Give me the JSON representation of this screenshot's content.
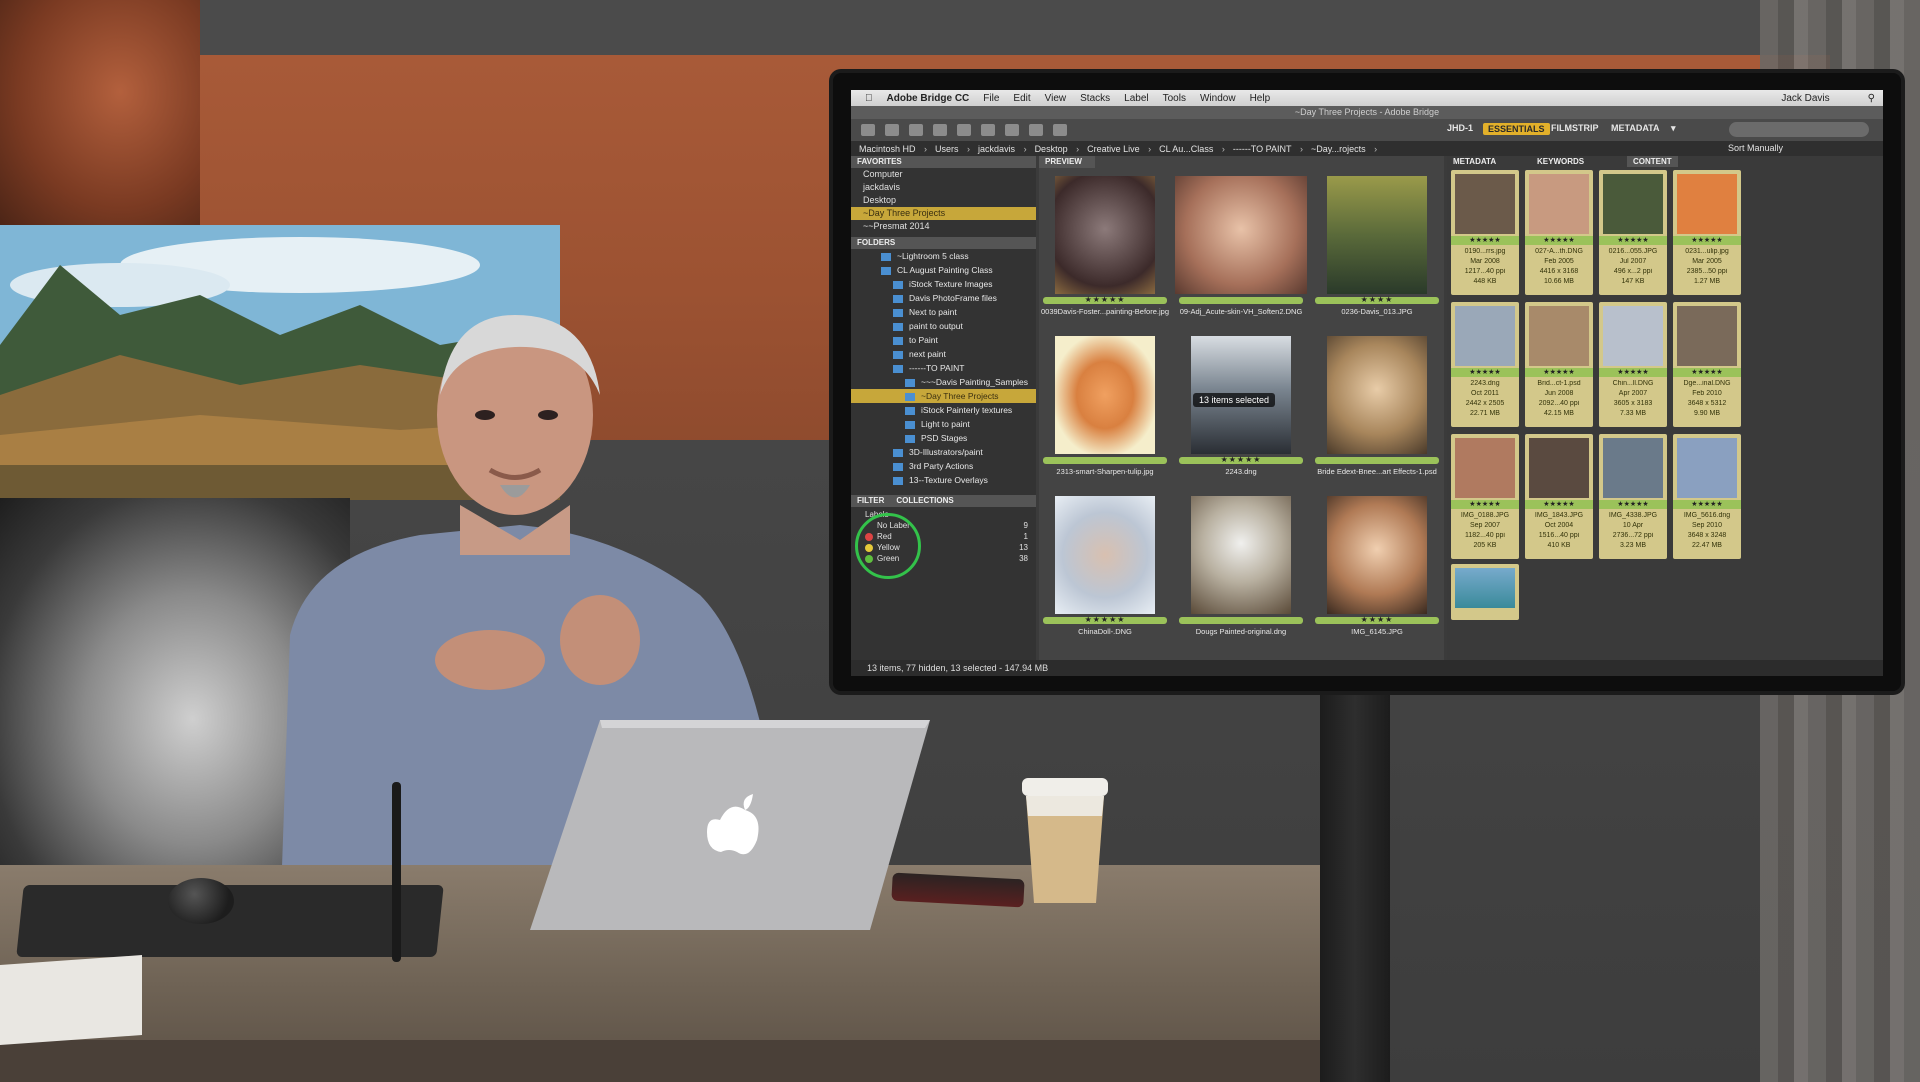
{
  "menubar": {
    "app": "Adobe Bridge CC",
    "menus": [
      "File",
      "Edit",
      "View",
      "Stacks",
      "Label",
      "Tools",
      "Window",
      "Help"
    ],
    "user": "Jack Davis"
  },
  "window_title": "~Day Three Projects - Adobe Bridge",
  "toolbar": {
    "workspaces": [
      "JHD-1",
      "ESSENTIALS",
      "FILMSTRIP",
      "METADATA"
    ],
    "active_workspace": "ESSENTIALS"
  },
  "path": [
    "Macintosh HD",
    "Users",
    "jackdavis",
    "Desktop",
    "Creative Live",
    "CL Au...Class",
    "------TO PAINT",
    "~Day...rojects"
  ],
  "sort": "Sort Manually",
  "left_panel": {
    "favorites_tab": "FAVORITES",
    "favorites": [
      "Computer",
      "jackdavis",
      "Desktop",
      "~Day Three Projects",
      "~~Presmat 2014"
    ],
    "folders_tab": "FOLDERS",
    "folders": [
      "~Lightroom 5 class",
      "CL August Painting Class",
      "iStock Texture Images",
      "Davis PhotoFrame files",
      "Next to paint",
      "paint to output",
      "to Paint",
      "next paint",
      "------TO PAINT",
      "~~~Davis Painting_Samples",
      "~Day Three Projects",
      "iStock Painterly textures",
      "Light to paint",
      "PSD Stages",
      "3D-Illustrators/paint",
      "3rd Party Actions",
      "13--Texture Overlays"
    ],
    "filter_tabs": [
      "FILTER",
      "COLLECTIONS"
    ],
    "filter_heading": "Labels",
    "filter_rows": [
      {
        "label": "No Label",
        "count": "9"
      },
      {
        "label": "Red",
        "count": "1"
      },
      {
        "label": "Yellow",
        "count": "13"
      },
      {
        "label": "Green",
        "count": "38"
      }
    ]
  },
  "content": {
    "tab": "PREVIEW",
    "overlay": "13 items selected",
    "items": [
      {
        "name": "0039Davis-Foster...painting-Before.jpg",
        "stars": "★★★★★"
      },
      {
        "name": "09-Adj_Acute-skin-VH_Soften2.DNG",
        "stars": ""
      },
      {
        "name": "0236-Davis_013.JPG",
        "stars": "★★★★"
      },
      {
        "name": "2313-smart-Sharpen-tulip.jpg",
        "stars": ""
      },
      {
        "name": "2243.dng",
        "stars": "★★★★★"
      },
      {
        "name": "Bride Edext-Bnee...art Effects-1.psd",
        "stars": ""
      },
      {
        "name": "ChinaDoll-.DNG",
        "stars": "★★★★★"
      },
      {
        "name": "Dougs Painted-original.dng",
        "stars": ""
      },
      {
        "name": "IMG_6145.JPG",
        "stars": "★★★★"
      }
    ]
  },
  "right_panel": {
    "tabs": [
      "METADATA",
      "KEYWORDS",
      "CONTENT"
    ],
    "items": [
      {
        "name": "0190...rrs.jpg",
        "date": "Mar 2008",
        "size": "1217...40 ppi",
        "bytes": "448 KB"
      },
      {
        "name": "027-A...th.DNG",
        "date": "Feb 2005",
        "size": "4416 x 3168",
        "bytes": "10.66 MB"
      },
      {
        "name": "0216...055.JPG",
        "date": "Jul 2007",
        "size": "496 x...2 ppi",
        "bytes": "147 KB"
      },
      {
        "name": "0231...ulip.jpg",
        "date": "Mar 2005",
        "size": "2385...50 ppi",
        "bytes": "1.27 MB"
      },
      {
        "name": "2243.dng",
        "date": "Oct 2011",
        "size": "2442 x 2505",
        "bytes": "22.71 MB"
      },
      {
        "name": "Brid...ct-1.psd",
        "date": "Jun 2008",
        "size": "2092...40 ppi",
        "bytes": "42.15 MB"
      },
      {
        "name": "Chin...ll.DNG",
        "date": "Apr 2007",
        "size": "3605 x 3183",
        "bytes": "7.33 MB"
      },
      {
        "name": "Dge...inal.DNG",
        "date": "Feb 2010",
        "size": "3648 x 5312",
        "bytes": "9.90 MB"
      },
      {
        "name": "IMG_0188.JPG",
        "date": "Sep 2007",
        "size": "1182...40 ppi",
        "bytes": "205 KB"
      },
      {
        "name": "IMG_1843.JPG",
        "date": "Oct 2004",
        "size": "1516...40 ppi",
        "bytes": "410 KB"
      },
      {
        "name": "IMG_4338.JPG",
        "date": "10 Apr",
        "size": "2736...72 ppi",
        "bytes": "3.23 MB"
      },
      {
        "name": "IMG_5616.dng",
        "date": "Sep 2010",
        "size": "3648 x 3248",
        "bytes": "22.47 MB"
      }
    ]
  },
  "status": "13 items, 77 hidden, 13 selected - 147.94 MB"
}
